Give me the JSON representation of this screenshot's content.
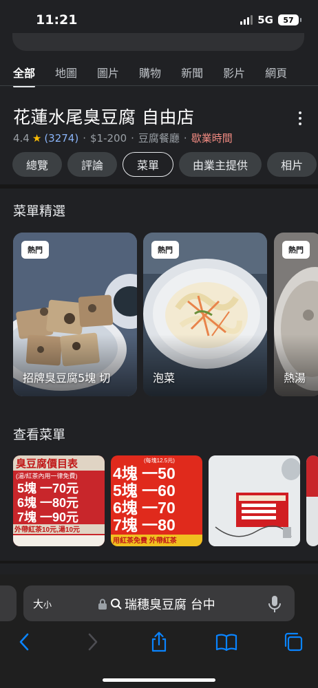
{
  "status_bar": {
    "time": "11:21",
    "network": "5G",
    "battery": "57"
  },
  "tabs": [
    {
      "label": "全部",
      "active": true
    },
    {
      "label": "地圖"
    },
    {
      "label": "圖片"
    },
    {
      "label": "購物"
    },
    {
      "label": "新聞"
    },
    {
      "label": "影片"
    },
    {
      "label": "網頁"
    }
  ],
  "place": {
    "title": "花蓮水尾臭豆腐 自由店",
    "rating": "4.4",
    "reviews": "(3274)",
    "price": "$1-200",
    "category": "豆腐餐廳",
    "hours": "歇業時間"
  },
  "chips": [
    {
      "label": "總覽"
    },
    {
      "label": "評論"
    },
    {
      "label": "菜單",
      "selected": true
    },
    {
      "label": "由業主提供"
    },
    {
      "label": "相片"
    }
  ],
  "menu_highlights": {
    "heading": "菜單精選",
    "items": [
      {
        "badge": "熱門",
        "name": "招牌臭豆腐5塊 切"
      },
      {
        "badge": "熱門",
        "name": "泡菜"
      },
      {
        "badge": "熱門",
        "name": "熱湯"
      }
    ]
  },
  "menu_section": {
    "heading": "查看菜單",
    "image1": {
      "title": "臭豆腐價目表",
      "note": "(湯/紅茶內用一律免費)",
      "lines": [
        "5塊 一70元",
        "6塊 一80元",
        "7塊 一90元"
      ],
      "footer": "外帶紅茶10元,湯10元"
    },
    "image2": {
      "top": "(每塊12.5元)",
      "lines": [
        "4塊 一50",
        "5塊 一60",
        "6塊 一70",
        "7塊 一80"
      ],
      "footer": "用紅茶免費 外帶紅茶"
    }
  },
  "browser": {
    "text_size": "大",
    "text_size_small": "小",
    "query": "瑞穗臭豆腐 台中"
  },
  "icons": {
    "star": "star-icon",
    "more": "more-vert-icon",
    "lock": "lock-icon",
    "search": "search-icon",
    "mic": "mic-icon",
    "back": "back-icon",
    "forward": "forward-icon",
    "share": "share-icon",
    "bookmarks": "bookmarks-icon",
    "tabs": "tabs-icon"
  },
  "colors": {
    "background": "#202124",
    "link": "#8ab4f8",
    "closed": "#f28b82",
    "star": "#fbbc04",
    "ios_blue": "#0a84ff"
  }
}
